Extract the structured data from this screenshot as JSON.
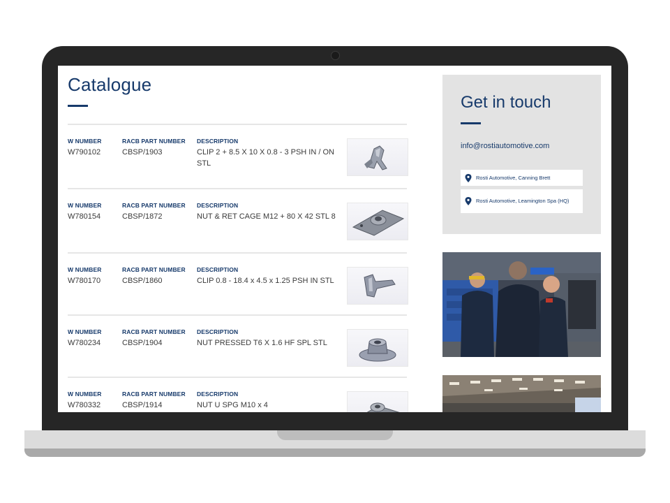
{
  "catalogue": {
    "title": "Catalogue",
    "column_labels": {
      "w_number": "W NUMBER",
      "racb": "RACB PART NUMBER",
      "description": "DESCRIPTION"
    },
    "items": [
      {
        "w_number": "W790102",
        "racb": "CBSP/1903",
        "description": "CLIP 2 + 8.5 X 10 X 0.8 - 3 PSH IN / ON STL",
        "thumb_icon": "spring-clip-icon"
      },
      {
        "w_number": "W780154",
        "racb": "CBSP/1872",
        "description": "NUT & RET CAGE M12 + 80 X 42 STL 8",
        "thumb_icon": "cage-nut-plate-icon"
      },
      {
        "w_number": "W780170",
        "racb": "CBSP/1860",
        "description": "CLIP 0.8 - 18.4 x 4.5 x 1.25 PSH IN STL",
        "thumb_icon": "push-clip-icon"
      },
      {
        "w_number": "W780234",
        "racb": "CBSP/1904",
        "description": "NUT PRESSED T6 X 1.6 HF SPL STL",
        "thumb_icon": "flange-nut-icon"
      },
      {
        "w_number": "W780332",
        "racb": "CBSP/1914",
        "description": "NUT U SPG M10 x 4",
        "thumb_icon": "u-nut-icon"
      }
    ]
  },
  "contact": {
    "title": "Get in touch",
    "email": "info@rostiautomotive.com",
    "locations": [
      {
        "label": "Rosti Automotive, Canning Brett",
        "icon": "map-pin-icon"
      },
      {
        "label": "Rosti Automotive, Leamington Spa (HQ)",
        "icon": "map-pin-icon"
      }
    ]
  },
  "colors": {
    "brand_navy": "#173a6b",
    "card_grey": "#e3e3e3",
    "laptop_bezel": "#262626"
  }
}
